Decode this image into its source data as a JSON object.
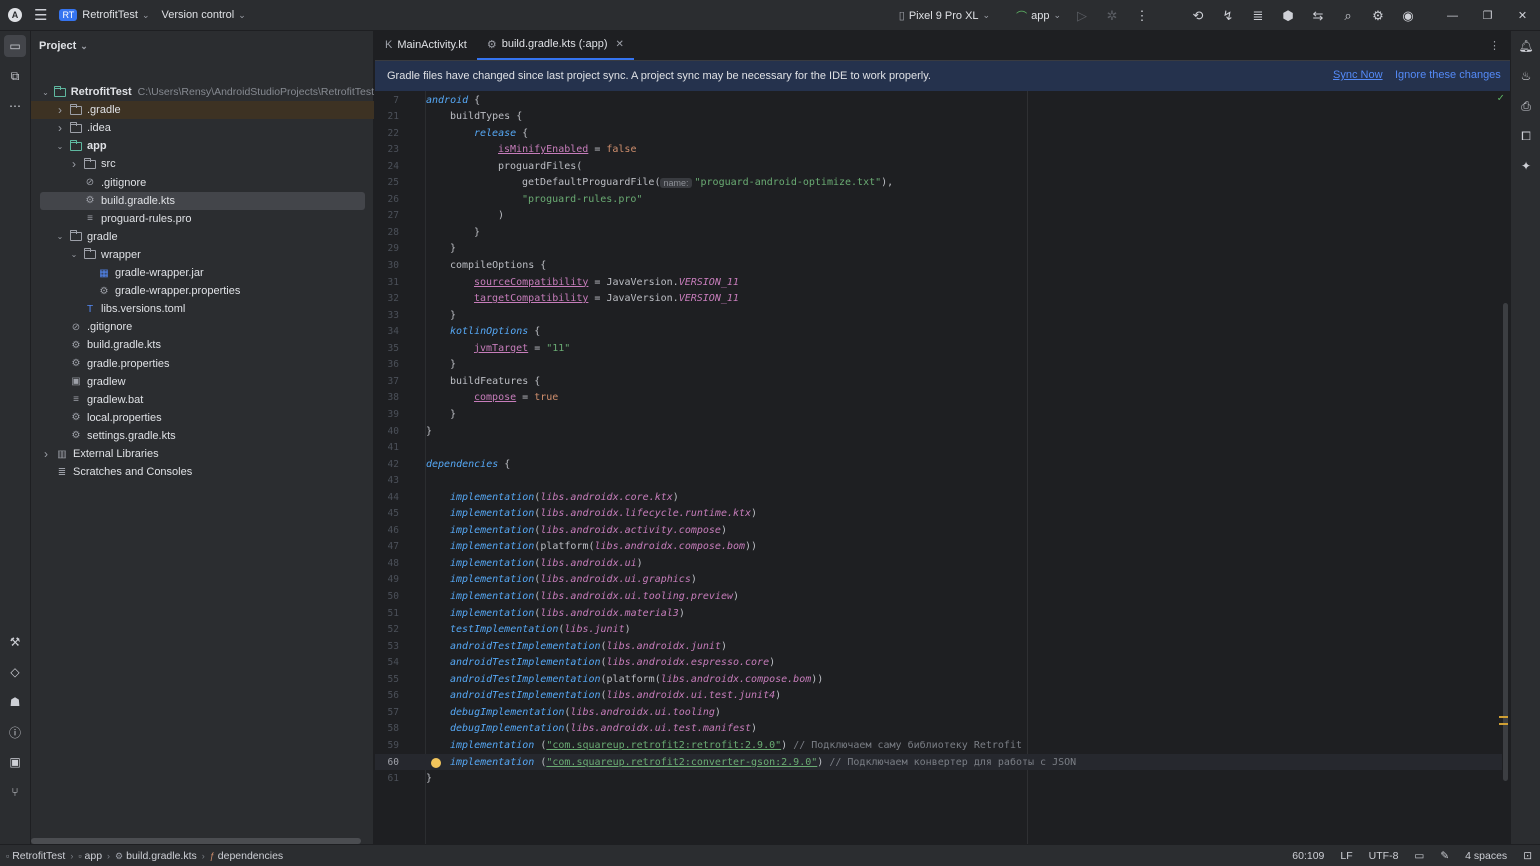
{
  "titlebar": {
    "project_badge": "RT",
    "project_name": "RetrofitTest",
    "vcs_label": "Version control",
    "device": "Pixel 9 Pro XL",
    "run_config": "app"
  },
  "project_panel": {
    "title": "Project",
    "tree": [
      {
        "label": "RetrofitTest",
        "path": "C:\\Users\\Rensy\\AndroidStudioProjects\\RetrofitTest",
        "depth": 0,
        "arrow": "open",
        "icon": "module-folder-icon",
        "bold": true
      },
      {
        "label": ".gradle",
        "depth": 1,
        "arrow": "closed",
        "icon": "folder-icon",
        "highlight": true
      },
      {
        "label": ".idea",
        "depth": 1,
        "arrow": "closed",
        "icon": "folder-icon"
      },
      {
        "label": "app",
        "depth": 1,
        "arrow": "open",
        "icon": "module-folder-icon",
        "bold": true
      },
      {
        "label": "src",
        "depth": 2,
        "arrow": "closed",
        "icon": "folder-icon"
      },
      {
        "label": ".gitignore",
        "depth": 2,
        "arrow": "none",
        "icon": "ignore-file-icon"
      },
      {
        "label": "build.gradle.kts",
        "depth": 2,
        "arrow": "none",
        "icon": "gradle-file-icon",
        "selected": true
      },
      {
        "label": "proguard-rules.pro",
        "depth": 2,
        "arrow": "none",
        "icon": "text-file-icon"
      },
      {
        "label": "gradle",
        "depth": 1,
        "arrow": "open",
        "icon": "folder-icon"
      },
      {
        "label": "wrapper",
        "depth": 2,
        "arrow": "open",
        "icon": "folder-icon"
      },
      {
        "label": "gradle-wrapper.jar",
        "depth": 3,
        "arrow": "none",
        "icon": "jar-file-icon"
      },
      {
        "label": "gradle-wrapper.properties",
        "depth": 3,
        "arrow": "none",
        "icon": "properties-file-icon"
      },
      {
        "label": "libs.versions.toml",
        "depth": 2,
        "arrow": "none",
        "icon": "toml-file-icon"
      },
      {
        "label": ".gitignore",
        "depth": 1,
        "arrow": "none",
        "icon": "ignore-file-icon"
      },
      {
        "label": "build.gradle.kts",
        "depth": 1,
        "arrow": "none",
        "icon": "gradle-file-icon"
      },
      {
        "label": "gradle.properties",
        "depth": 1,
        "arrow": "none",
        "icon": "properties-file-icon"
      },
      {
        "label": "gradlew",
        "depth": 1,
        "arrow": "none",
        "icon": "shell-file-icon"
      },
      {
        "label": "gradlew.bat",
        "depth": 1,
        "arrow": "none",
        "icon": "text-file-icon"
      },
      {
        "label": "local.properties",
        "depth": 1,
        "arrow": "none",
        "icon": "properties-file-icon"
      },
      {
        "label": "settings.gradle.kts",
        "depth": 1,
        "arrow": "none",
        "icon": "gradle-file-icon"
      },
      {
        "label": "External Libraries",
        "depth": 0,
        "arrow": "closed",
        "icon": "library-icon"
      },
      {
        "label": "Scratches and Consoles",
        "depth": 0,
        "arrow": "none",
        "icon": "scratches-icon"
      }
    ]
  },
  "editor": {
    "tabs": [
      {
        "label": "MainActivity.kt",
        "icon": "kotlin-file-icon",
        "active": false
      },
      {
        "label": "build.gradle.kts (:app)",
        "icon": "gradle-file-icon",
        "active": true
      }
    ],
    "banner": {
      "message": "Gradle files have changed since last project sync. A project sync may be necessary for the IDE to work properly.",
      "sync_now": "Sync Now",
      "ignore": "Ignore these changes"
    },
    "current_line": 60,
    "lines": [
      {
        "n": "7",
        "indent": 0,
        "parts": [
          [
            "kw-fn",
            "android"
          ],
          [
            "src",
            " {"
          ]
        ]
      },
      {
        "n": "21",
        "indent": 1,
        "parts": [
          [
            "src",
            "buildTypes {"
          ]
        ]
      },
      {
        "n": "22",
        "indent": 2,
        "parts": [
          [
            "fn",
            "release"
          ],
          [
            "src",
            " {"
          ]
        ]
      },
      {
        "n": "23",
        "indent": 3,
        "parts": [
          [
            "prop",
            "isMinifyEnabled"
          ],
          [
            "src",
            " = "
          ],
          [
            "kw",
            "false"
          ]
        ]
      },
      {
        "n": "24",
        "indent": 3,
        "parts": [
          [
            "src",
            "proguardFiles("
          ]
        ]
      },
      {
        "n": "25",
        "indent": 4,
        "parts": [
          [
            "src",
            "getDefaultProguardFile("
          ],
          [
            "hint",
            "name:"
          ],
          [
            "str",
            "\"proguard-android-optimize.txt\""
          ],
          [
            "src",
            "),"
          ]
        ]
      },
      {
        "n": "26",
        "indent": 4,
        "parts": [
          [
            "str",
            "\"proguard-rules.pro\""
          ]
        ]
      },
      {
        "n": "27",
        "indent": 3,
        "parts": [
          [
            "src",
            ")"
          ]
        ]
      },
      {
        "n": "28",
        "indent": 2,
        "parts": [
          [
            "src",
            "}"
          ]
        ]
      },
      {
        "n": "29",
        "indent": 1,
        "parts": [
          [
            "src",
            "}"
          ]
        ]
      },
      {
        "n": "30",
        "indent": 1,
        "parts": [
          [
            "src",
            "compileOptions {"
          ]
        ]
      },
      {
        "n": "31",
        "indent": 2,
        "parts": [
          [
            "prop",
            "sourceCompatibility"
          ],
          [
            "src",
            " = JavaVersion."
          ],
          [
            "ext",
            "VERSION_11"
          ]
        ]
      },
      {
        "n": "32",
        "indent": 2,
        "parts": [
          [
            "prop",
            "targetCompatibility"
          ],
          [
            "src",
            " = JavaVersion."
          ],
          [
            "ext",
            "VERSION_11"
          ]
        ]
      },
      {
        "n": "33",
        "indent": 1,
        "parts": [
          [
            "src",
            "}"
          ]
        ]
      },
      {
        "n": "34",
        "indent": 1,
        "parts": [
          [
            "fn",
            "kotlinOptions"
          ],
          [
            "src",
            " {"
          ]
        ]
      },
      {
        "n": "35",
        "indent": 2,
        "parts": [
          [
            "prop",
            "jvmTarget"
          ],
          [
            "src",
            " = "
          ],
          [
            "str",
            "\"11\""
          ]
        ]
      },
      {
        "n": "36",
        "indent": 1,
        "parts": [
          [
            "src",
            "}"
          ]
        ]
      },
      {
        "n": "37",
        "indent": 1,
        "parts": [
          [
            "src",
            "buildFeatures {"
          ]
        ]
      },
      {
        "n": "38",
        "indent": 2,
        "parts": [
          [
            "prop",
            "compose"
          ],
          [
            "src",
            " = "
          ],
          [
            "kw",
            "true"
          ]
        ]
      },
      {
        "n": "39",
        "indent": 1,
        "parts": [
          [
            "src",
            "}"
          ]
        ]
      },
      {
        "n": "40",
        "indent": 0,
        "parts": [
          [
            "src",
            "}"
          ]
        ]
      },
      {
        "n": "41",
        "indent": 0,
        "parts": []
      },
      {
        "n": "42",
        "indent": 0,
        "parts": [
          [
            "fn",
            "dependencies"
          ],
          [
            "src",
            " {"
          ]
        ]
      },
      {
        "n": "43",
        "indent": 0,
        "parts": []
      },
      {
        "n": "44",
        "indent": 1,
        "parts": [
          [
            "fn",
            "implementation"
          ],
          [
            "src",
            "("
          ],
          [
            "ext",
            "libs.androidx.core.ktx"
          ],
          [
            "src",
            ")"
          ]
        ]
      },
      {
        "n": "45",
        "indent": 1,
        "parts": [
          [
            "fn",
            "implementation"
          ],
          [
            "src",
            "("
          ],
          [
            "ext",
            "libs.androidx.lifecycle.runtime.ktx"
          ],
          [
            "src",
            ")"
          ]
        ]
      },
      {
        "n": "46",
        "indent": 1,
        "parts": [
          [
            "fn",
            "implementation"
          ],
          [
            "src",
            "("
          ],
          [
            "ext",
            "libs.androidx.activity.compose"
          ],
          [
            "src",
            ")"
          ]
        ]
      },
      {
        "n": "47",
        "indent": 1,
        "parts": [
          [
            "fn",
            "implementation"
          ],
          [
            "src",
            "(platform("
          ],
          [
            "ext",
            "libs.androidx.compose.bom"
          ],
          [
            "src",
            "))"
          ]
        ]
      },
      {
        "n": "48",
        "indent": 1,
        "parts": [
          [
            "fn",
            "implementation"
          ],
          [
            "src",
            "("
          ],
          [
            "ext",
            "libs.androidx.ui"
          ],
          [
            "src",
            ")"
          ]
        ]
      },
      {
        "n": "49",
        "indent": 1,
        "parts": [
          [
            "fn",
            "implementation"
          ],
          [
            "src",
            "("
          ],
          [
            "ext",
            "libs.androidx.ui.graphics"
          ],
          [
            "src",
            ")"
          ]
        ]
      },
      {
        "n": "50",
        "indent": 1,
        "parts": [
          [
            "fn",
            "implementation"
          ],
          [
            "src",
            "("
          ],
          [
            "ext",
            "libs.androidx.ui.tooling.preview"
          ],
          [
            "src",
            ")"
          ]
        ]
      },
      {
        "n": "51",
        "indent": 1,
        "parts": [
          [
            "fn",
            "implementation"
          ],
          [
            "src",
            "("
          ],
          [
            "ext",
            "libs.androidx.material3"
          ],
          [
            "src",
            ")"
          ]
        ]
      },
      {
        "n": "52",
        "indent": 1,
        "parts": [
          [
            "fn",
            "testImplementation"
          ],
          [
            "src",
            "("
          ],
          [
            "ext",
            "libs.junit"
          ],
          [
            "src",
            ")"
          ]
        ]
      },
      {
        "n": "53",
        "indent": 1,
        "parts": [
          [
            "fn",
            "androidTestImplementation"
          ],
          [
            "src",
            "("
          ],
          [
            "ext",
            "libs.androidx.junit"
          ],
          [
            "src",
            ")"
          ]
        ]
      },
      {
        "n": "54",
        "indent": 1,
        "parts": [
          [
            "fn",
            "androidTestImplementation"
          ],
          [
            "src",
            "("
          ],
          [
            "ext",
            "libs.androidx.espresso.core"
          ],
          [
            "src",
            ")"
          ]
        ]
      },
      {
        "n": "55",
        "indent": 1,
        "parts": [
          [
            "fn",
            "androidTestImplementation"
          ],
          [
            "src",
            "(platform("
          ],
          [
            "ext",
            "libs.androidx.compose.bom"
          ],
          [
            "src",
            "))"
          ]
        ]
      },
      {
        "n": "56",
        "indent": 1,
        "parts": [
          [
            "fn",
            "androidTestImplementation"
          ],
          [
            "src",
            "("
          ],
          [
            "ext",
            "libs.androidx.ui.test.junit4"
          ],
          [
            "src",
            ")"
          ]
        ]
      },
      {
        "n": "57",
        "indent": 1,
        "parts": [
          [
            "fn",
            "debugImplementation"
          ],
          [
            "src",
            "("
          ],
          [
            "ext",
            "libs.androidx.ui.tooling"
          ],
          [
            "src",
            ")"
          ]
        ]
      },
      {
        "n": "58",
        "indent": 1,
        "parts": [
          [
            "fn",
            "debugImplementation"
          ],
          [
            "src",
            "("
          ],
          [
            "ext",
            "libs.androidx.ui.test.manifest"
          ],
          [
            "src",
            ")"
          ]
        ]
      },
      {
        "n": "59",
        "indent": 1,
        "parts": [
          [
            "fn",
            "implementation"
          ],
          [
            "src",
            " ("
          ],
          [
            "strlink",
            "\"com.squareup.retrofit2:retrofit:2.9.0\""
          ],
          [
            "src",
            ") "
          ],
          [
            "cmt",
            "// Подключаем саму библиотеку Retrofit"
          ]
        ]
      },
      {
        "n": "60",
        "indent": 1,
        "parts": [
          [
            "fn",
            "implementation"
          ],
          [
            "src",
            " ("
          ],
          [
            "strlink",
            "\"com.squareup.retrofit2:converter-gson:2.9.0\""
          ],
          [
            "src",
            ") "
          ],
          [
            "cmt",
            "// Подключаем конвертер для работы с JSON"
          ]
        ]
      },
      {
        "n": "61",
        "indent": 0,
        "parts": [
          [
            "src",
            "}"
          ]
        ]
      }
    ]
  },
  "statusbar": {
    "breadcrumbs": [
      {
        "label": "RetrofitTest",
        "icon": "module-icon"
      },
      {
        "label": "app",
        "icon": "module-icon"
      },
      {
        "label": "build.gradle.kts",
        "icon": "gradle-file-icon"
      },
      {
        "label": "dependencies",
        "icon": "function-icon"
      }
    ],
    "position": "60:109",
    "line_sep": "LF",
    "encoding": "UTF-8",
    "indent": "4 spaces"
  },
  "colors": {
    "accent": "#3574f0",
    "background": "#1e1f22",
    "panel": "#2b2d30",
    "banner": "#25324d"
  }
}
